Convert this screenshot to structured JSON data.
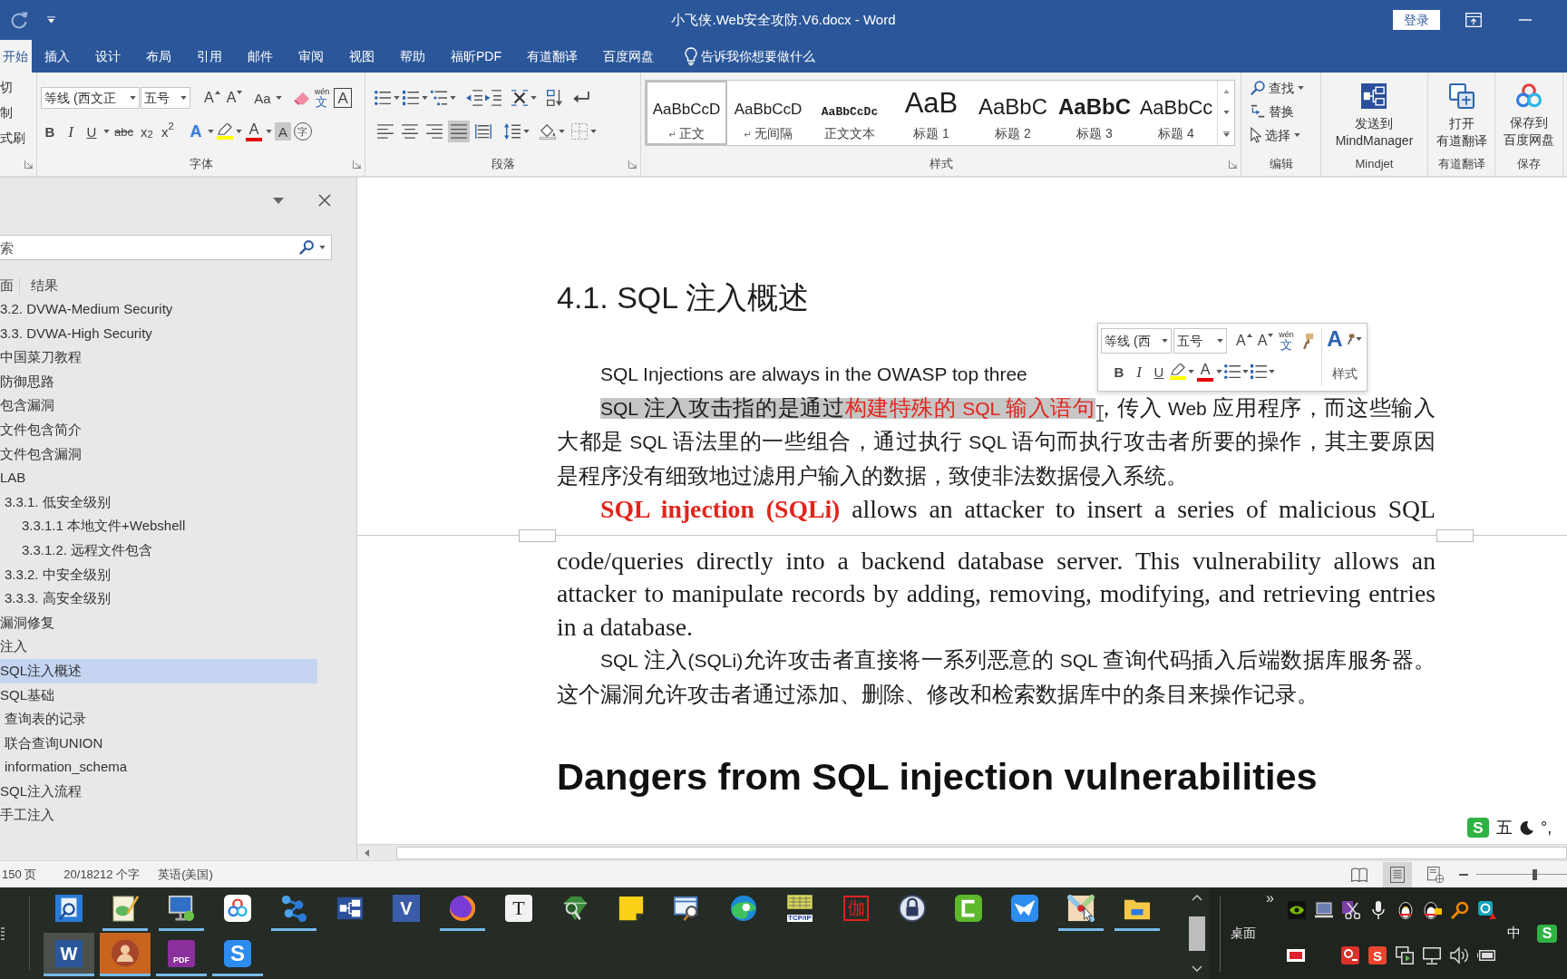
{
  "title_bar": {
    "title": "小飞侠.Web安全攻防.V6.docx - Word",
    "sign_in": "登录"
  },
  "ribbon_tabs": [
    {
      "label": "开始",
      "selected": true
    },
    {
      "label": "插入",
      "selected": false
    },
    {
      "label": "设计",
      "selected": false
    },
    {
      "label": "布局",
      "selected": false
    },
    {
      "label": "引用",
      "selected": false
    },
    {
      "label": "邮件",
      "selected": false
    },
    {
      "label": "审阅",
      "selected": false
    },
    {
      "label": "视图",
      "selected": false
    },
    {
      "label": "帮助",
      "selected": false
    },
    {
      "label": "福昕PDF",
      "selected": false
    },
    {
      "label": "有道翻译",
      "selected": false
    },
    {
      "label": "百度网盘",
      "selected": false
    }
  ],
  "tell_me": "告诉我你想要做什么",
  "ribbon": {
    "clipboard": {
      "commands": [
        "切",
        "制",
        "式刷"
      ]
    },
    "font": {
      "label": "字体",
      "row1": [
        {
          "kind": "font_name",
          "text": "等线 (西文正",
          "dropdown": true
        },
        {
          "kind": "font_size",
          "text": "五号",
          "dropdown": true
        },
        {
          "kind": "grow",
          "text": "A",
          "dropdown": false
        },
        {
          "kind": "shrink",
          "text": "A",
          "dropdown": false
        },
        {
          "kind": "case",
          "text": "Aa",
          "dropdown": true
        },
        {
          "kind": "eraser",
          "dropdown": false
        },
        {
          "kind": "phonetic",
          "ruby": "wén",
          "text": "文",
          "dropdown": false
        },
        {
          "kind": "boxed",
          "text": "A",
          "dropdown": false
        }
      ],
      "row2": [
        {
          "kind": "bold",
          "text": "B",
          "dropdown": false
        },
        {
          "kind": "italic",
          "text": "I",
          "dropdown": false
        },
        {
          "kind": "underline",
          "text": "U",
          "dropdown": true
        },
        {
          "kind": "strike",
          "text": "abc",
          "dropdown": false
        },
        {
          "kind": "subscript",
          "text": "x$_{2}$",
          "dropdown": false
        },
        {
          "kind": "superscript",
          "text": "x$^{2}$",
          "dropdown": false
        },
        {
          "kind": "effects",
          "text": "A",
          "dropdown": true
        },
        {
          "kind": "highlight",
          "color": "#ffff00",
          "dropdown": true
        },
        {
          "kind": "color",
          "text": "A",
          "color": "#e60000",
          "dropdown": true
        },
        {
          "kind": "shading",
          "text": "A",
          "dropdown": false
        },
        {
          "kind": "enclose",
          "text": "字",
          "dropdown": false
        }
      ]
    },
    "paragraph": {
      "label": "段落",
      "row1": [
        {
          "kind": "bullets",
          "dropdown": true
        },
        {
          "kind": "numbering",
          "dropdown": true
        },
        {
          "kind": "multilevel",
          "dropdown": true
        },
        {
          "kind": "outdent",
          "dropdown": false
        },
        {
          "kind": "indent",
          "dropdown": false
        },
        {
          "kind": "asian",
          "dropdown": true
        },
        {
          "kind": "sort",
          "dropdown": false
        },
        {
          "kind": "marks",
          "dropdown": false
        }
      ],
      "align": [
        {
          "kind": "left",
          "selected": false
        },
        {
          "kind": "center",
          "selected": false
        },
        {
          "kind": "right",
          "selected": false
        },
        {
          "kind": "justify",
          "selected": true
        },
        {
          "kind": "distribute",
          "selected": false
        }
      ],
      "row2": [
        {
          "kind": "spacing",
          "dropdown": true
        },
        {
          "kind": "fill",
          "dropdown": true
        },
        {
          "kind": "borders",
          "dropdown": true
        }
      ]
    },
    "styles": {
      "label": "样式",
      "items": [
        {
          "kind": "normal",
          "preview": "AaBbCcD",
          "symbol": "↵",
          "name": "正文",
          "selected": true
        },
        {
          "kind": "normal",
          "preview": "AaBbCcD",
          "symbol": "↵",
          "name": "无间隔",
          "selected": false
        },
        {
          "kind": "mono",
          "preview": "AaBbCcDc",
          "name": "正文文本",
          "selected": false
        },
        {
          "kind": "h1",
          "preview": "AaB",
          "name": "标题 1",
          "selected": false
        },
        {
          "kind": "h2",
          "preview": "AaBbC",
          "name": "标题 2",
          "selected": false
        },
        {
          "kind": "h3",
          "preview": "AaBbC",
          "name": "标题 3",
          "selected": false
        },
        {
          "kind": "h4",
          "preview": "AaBbCc",
          "name": "标题 4",
          "selected": false
        }
      ]
    },
    "editing": {
      "label": "编辑",
      "items": [
        {
          "kind": "find",
          "text": "查找",
          "dropdown": true
        },
        {
          "kind": "replace",
          "text": "替换",
          "dropdown": false
        },
        {
          "kind": "select",
          "text": "选择",
          "dropdown": true
        }
      ]
    },
    "addins": [
      {
        "kind": "mindmap",
        "lines": [
          "发送到",
          "MindManager"
        ],
        "label": "Mindjet"
      },
      {
        "kind": "translate",
        "lines": [
          "打开",
          "有道翻译"
        ],
        "label": "有道翻译"
      },
      {
        "kind": "rings",
        "lines": [
          "保存到",
          "百度网盘"
        ],
        "label": "保存"
      }
    ]
  },
  "navigation": {
    "search_placeholder": "索",
    "tabs": [
      "面",
      "结果"
    ],
    "items": [
      {
        "text": "3.2. DVWA-Medium Security",
        "selected": false
      },
      {
        "text": "3.3. DVWA-High Security",
        "selected": false
      },
      {
        "text": "中国菜刀教程",
        "selected": false
      },
      {
        "text": "防御思路",
        "selected": false
      },
      {
        "text": "包含漏洞",
        "selected": false
      },
      {
        "text": "文件包含简介",
        "selected": false
      },
      {
        "text": "文件包含漏洞",
        "selected": false
      },
      {
        "text": "LAB",
        "selected": false,
        "children": [
          {
            "text": "3.3.1. 低安全级别",
            "selected": false,
            "children": [
              {
                "text": "3.3.1.1 本地文件+Webshell",
                "selected": false
              },
              {
                "text": "3.3.1.2. 远程文件包含",
                "selected": false
              }
            ]
          },
          {
            "text": "3.3.2. 中安全级别",
            "selected": false
          },
          {
            "text": "3.3.3. 高安全级别",
            "selected": false
          }
        ]
      },
      {
        "text": "漏洞修复",
        "selected": false
      },
      {
        "text": "注入",
        "selected": false
      },
      {
        "text": "SQL注入概述",
        "selected": true
      },
      {
        "text": "SQL基础",
        "selected": false,
        "children": [
          {
            "text": "查询表的记录",
            "selected": false
          },
          {
            "text": "联合查询UNION",
            "selected": false
          },
          {
            "text": "information_schema",
            "selected": false
          }
        ]
      },
      {
        "text": "SQL注入流程",
        "selected": false
      },
      {
        "text": "手工注入",
        "selected": false
      }
    ]
  },
  "document": {
    "pages": [
      {
        "blocks": [
          {
            "kind": "heading",
            "text": "4.1. SQL 注入概述"
          },
          {
            "kind": "sans",
            "segments": [
              {
                "kind": "plain",
                "text": "SQL Injections are always in the OWASP top three"
              }
            ]
          },
          {
            "kind": "sans",
            "segments": [
              {
                "kind": "selected",
                "text": "SQL 注入攻击指的是通过"
              },
              {
                "kind": "selected_red",
                "text": "构建特殊的 SQL 输入语句"
              },
              {
                "kind": "plain",
                "text": "，传入 Web 应用程序，而这些输入大都是 SQL 语法里的一些组合，通过执行 SQL 语句而执行攻击者所要的操作，其主要原因是程序没有细致地过滤用户输入的数据，致使非法数据侵入系统。"
              }
            ]
          },
          {
            "kind": "serif_split",
            "segments": [
              {
                "kind": "bold_red",
                "text": "SQL injection (SQLi)"
              },
              {
                "kind": "plain",
                "text": " allows an attacker to insert a series of malicious SQL"
              }
            ]
          }
        ]
      },
      {
        "blocks": [
          {
            "kind": "serif_rest",
            "segments": [
              {
                "kind": "plain",
                "text": "code/queries directly into a backend database server. This vulnerability allows an attacker to manipulate records by adding, removing, modifying, and retrieving entries in a database."
              }
            ]
          },
          {
            "kind": "sans",
            "segments": [
              {
                "kind": "plain",
                "text": "SQL 注入(SQLi)允许攻击者直接将一系列恶意的 SQL 查询代码插入后端数据库服务器。这个漏洞允许攻击者通过添加、删除、修改和检索数据库中的条目来操作记录。"
              }
            ]
          },
          {
            "kind": "heading2",
            "text": "Dangers from SQL injection vulnerabilities"
          }
        ]
      }
    ]
  },
  "mini_toolbar": {
    "row1": [
      {
        "kind": "font_name",
        "text": "等线 (西",
        "dropdown": true
      },
      {
        "kind": "font_size",
        "text": "五号",
        "dropdown": true
      },
      {
        "kind": "grow",
        "text": "A",
        "dropdown": false
      },
      {
        "kind": "shrink",
        "text": "A",
        "dropdown": false
      },
      {
        "kind": "phonetic",
        "ruby": "wén",
        "text": "文",
        "dropdown": false
      },
      {
        "kind": "painter",
        "dropdown": false
      }
    ],
    "row2": [
      {
        "kind": "bold",
        "text": "B",
        "dropdown": false
      },
      {
        "kind": "italic",
        "text": "I",
        "dropdown": false
      },
      {
        "kind": "underline",
        "text": "U",
        "dropdown": false
      },
      {
        "kind": "highlight",
        "color": "#ffff00",
        "dropdown": true
      },
      {
        "kind": "color",
        "text": "A",
        "color": "#e60000",
        "dropdown": true
      },
      {
        "kind": "bullets",
        "dropdown": true
      },
      {
        "kind": "numbering",
        "dropdown": true
      }
    ],
    "styles": {
      "text": "A",
      "label": "样式"
    }
  },
  "ime_bar": {
    "logo": "S",
    "mode": "五",
    "punctuation": "°,"
  },
  "status_bar": {
    "page": "150 页",
    "words": "20/18212 个字",
    "language": "英语(美国)",
    "views": [
      {
        "kind": "read",
        "selected": false
      },
      {
        "kind": "print",
        "selected": true
      },
      {
        "kind": "web",
        "selected": false
      }
    ],
    "zoom_slider": {
      "level": 0.64
    }
  },
  "taskbar": {
    "row1": [
      {
        "kind": "finder",
        "running": false
      },
      {
        "kind": "notepad",
        "running": true
      },
      {
        "kind": "monitor",
        "running": true
      },
      {
        "kind": "rings",
        "running": false
      },
      {
        "kind": "nodes",
        "running": true
      },
      {
        "kind": "mindmap",
        "running": false
      },
      {
        "kind": "vtile",
        "glyph": "V",
        "running": false
      },
      {
        "kind": "fox",
        "running": true
      },
      {
        "kind": "ttile",
        "glyph": "T",
        "running": false
      },
      {
        "kind": "gem",
        "running": false
      },
      {
        "kind": "note",
        "running": false
      },
      {
        "kind": "winsearch",
        "running": false
      },
      {
        "kind": "swirl",
        "running": false
      },
      {
        "kind": "calc",
        "glyph": "TCP/IP",
        "running": false
      },
      {
        "kind": "seal",
        "glyph": "伽",
        "running": false
      },
      {
        "kind": "lock",
        "running": false
      },
      {
        "kind": "bracket",
        "running": false
      },
      {
        "kind": "plane",
        "running": false
      },
      {
        "kind": "map",
        "running": true
      },
      {
        "kind": "folder",
        "running": true
      }
    ],
    "row2": [
      {
        "kind": "wtile",
        "glyph": "W",
        "running": true,
        "active": true
      },
      {
        "kind": "avatar",
        "running": true,
        "active": false
      },
      {
        "kind": "pdftile",
        "glyph": "PDF",
        "running": true,
        "active": false
      },
      {
        "kind": "stile",
        "glyph": "S",
        "running": true,
        "active": false
      }
    ],
    "more": "»",
    "desktop": "桌面",
    "tray_row1": [
      {
        "kind": "eye"
      },
      {
        "kind": "laptop"
      },
      {
        "kind": "scissors"
      },
      {
        "kind": "mic"
      },
      {
        "kind": "penguin"
      },
      {
        "kind": "penguin_chat"
      },
      {
        "kind": "magnifier"
      },
      {
        "kind": "alert"
      }
    ],
    "tray_row2": [
      {
        "kind": "record"
      },
      {
        "kind": "ring_tile"
      },
      {
        "kind": "stile_red",
        "glyph": "S"
      },
      {
        "kind": "play"
      },
      {
        "kind": "net"
      },
      {
        "kind": "vol"
      },
      {
        "kind": "batt"
      }
    ],
    "lang": "中",
    "ime": "S"
  }
}
